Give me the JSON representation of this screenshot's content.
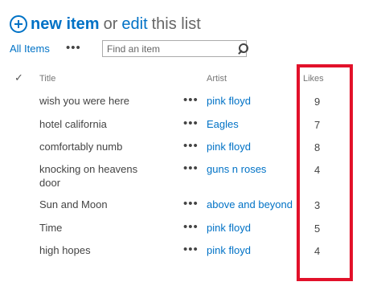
{
  "header": {
    "new_item": "new item",
    "or": "or",
    "edit": "edit",
    "rest": "this list",
    "icon": "plus-circle-icon"
  },
  "toolbar": {
    "view_tab": "All Items",
    "more": "•••",
    "search_placeholder": "Find an item"
  },
  "columns": {
    "check": "✓",
    "title": "Title",
    "artist": "Artist",
    "likes": "Likes"
  },
  "rows": [
    {
      "title": "wish you were here",
      "artist": "pink floyd",
      "likes": "9"
    },
    {
      "title": "hotel california",
      "artist": "Eagles",
      "likes": "7"
    },
    {
      "title": "comfortably numb",
      "artist": "pink floyd",
      "likes": "8"
    },
    {
      "title": "knocking on heavens door",
      "artist": "guns n roses",
      "likes": "4"
    },
    {
      "title": "Sun and Moon",
      "artist": "above and beyond",
      "likes": "3"
    },
    {
      "title": "Time",
      "artist": "pink floyd",
      "likes": "5"
    },
    {
      "title": "high hopes",
      "artist": "pink floyd",
      "likes": "4"
    }
  ],
  "row_menu": "•••",
  "colors": {
    "accent": "#0072c6",
    "highlight": "#e2112a"
  }
}
